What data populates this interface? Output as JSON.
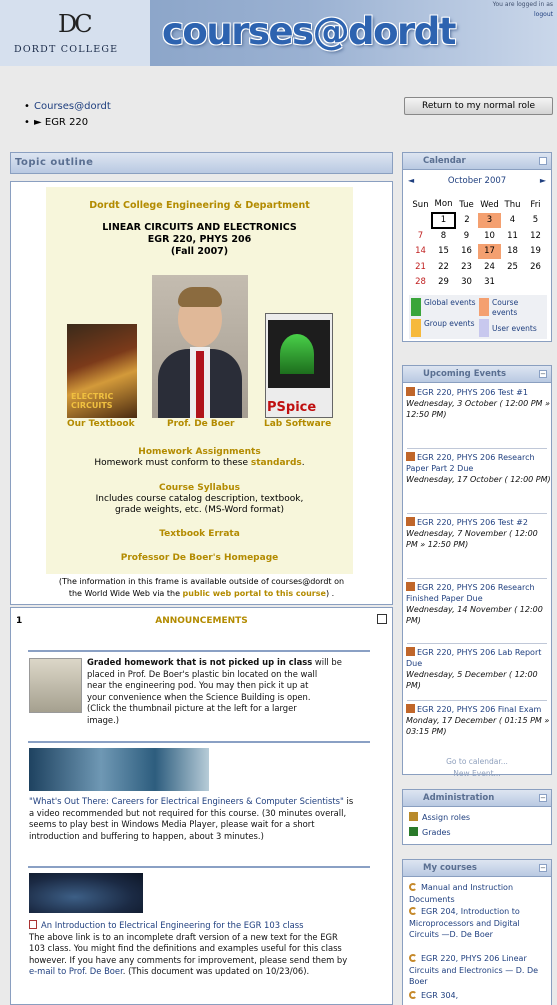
{
  "header": {
    "site_title": "courses@dordt",
    "logo_mark": "DC",
    "logo_text": "DORDT COLLEGE",
    "login_info": "You are logged in as",
    "logout": "logout"
  },
  "breadcrumb": [
    {
      "label": "Courses@dordt"
    },
    {
      "label": "► EGR 220"
    }
  ],
  "role_button": "Return to my normal role",
  "topic_outline": "Topic outline",
  "frame": {
    "title": "Dordt College Engineering & Department",
    "course_line1": "LINEAR CIRCUITS AND ELECTRONICS",
    "course_line2": "EGR 220, PHYS 206",
    "course_line3": "(Fall 2007)",
    "textbook_label": "Our Textbook",
    "textbook_cover": "ELECTRIC CIRCUITS",
    "prof_label": "Prof. De Boer",
    "software_label": "Lab Software",
    "pspice": "PSpice",
    "homework_title": "Homework Assignments",
    "homework_text": "Homework must conform to these",
    "homework_link": "standards",
    "syllabus_title": "Course Syllabus",
    "syllabus_text1": "Includes course catalog description, textbook,",
    "syllabus_text2": "grade weights, etc. (MS-Word format)",
    "errata": "Textbook Errata",
    "homepage": "Professor De Boer's Homepage"
  },
  "frame_note": {
    "line1": "(The information in this frame is available outside of courses@dordt on",
    "line2_pre": "the World Wide Web via the",
    "line2_link": "public web portal to this course",
    "line2_post": ") ."
  },
  "section1": {
    "number": "1",
    "title": "ANNOUNCEMENTS",
    "hw_bold": "Graded homework that is not picked up in class",
    "hw_text1": " will be",
    "hw_lines": [
      "placed in Prof. De Boer's plastic bin located on the wall",
      "near the engineering pod. You may then pick it up at",
      "your convenience when the Science Building is open.",
      "(Click the thumbnail picture at the left for a larger",
      "image.)"
    ],
    "video_link": "\"What's Out There: Careers for Electrical Engineers & Computer Scientists\"",
    "video_text_lead": " is",
    "video_lines": [
      "a video recommended but not required for this course. (30 minutes overall,",
      "seems to play best in Windows Media Player, please wait for a short",
      "introduction and buffering to happen, about 3 minutes.)"
    ],
    "intro_link": "An Introduction to Electrical Engineering for the EGR 103 class",
    "intro_lines": [
      "The above link is to an incomplete draft version of a new text for the EGR",
      "103 class.  You might find the definitions and examples useful for this class",
      "however.  If you have any comments for improvement, please send them by"
    ],
    "intro_email": "e-mail to Prof. De Boer",
    "intro_tail": ". (This document was updated on 10/23/06)."
  },
  "calendar": {
    "title": "Calendar",
    "month": "October 2007",
    "prev": "◄",
    "next": "►",
    "days": [
      "Sun",
      "Mon",
      "Tue",
      "Wed",
      "Thu",
      "Fri"
    ],
    "weeks": [
      [
        "",
        "1",
        "2",
        "3",
        "4",
        "5"
      ],
      [
        "7",
        "8",
        "9",
        "10",
        "11",
        "12"
      ],
      [
        "14",
        "15",
        "16",
        "17",
        "18",
        "19"
      ],
      [
        "21",
        "22",
        "23",
        "24",
        "25",
        "26"
      ],
      [
        "28",
        "29",
        "30",
        "31",
        "",
        ""
      ]
    ],
    "legend": {
      "global": "Global events",
      "course": "Course events",
      "group": "Group events",
      "user": "User events"
    }
  },
  "upcoming": {
    "title": "Upcoming Events",
    "events": [
      {
        "name": "EGR 220, PHYS 206 Test #1",
        "date": "Wednesday, 3 October",
        "time": "( 12:00 PM » 12:50 PM)"
      },
      {
        "name": "EGR 220, PHYS 206 Research Paper Part 2 Due",
        "date": "Wednesday, 17 October",
        "time": "( 12:00 PM)"
      },
      {
        "name": "EGR 220, PHYS 206 Test #2",
        "date": "Wednesday, 7 November",
        "time": "( 12:00 PM » 12:50 PM)"
      },
      {
        "name": "EGR 220, PHYS 206 Research Finished Paper Due",
        "date": "Wednesday, 14 November",
        "time": "( 12:00 PM)"
      },
      {
        "name": "EGR 220, PHYS 206 Lab Report Due",
        "date": "Wednesday, 5 December",
        "time": "( 12:00 PM)"
      },
      {
        "name": "EGR 220, PHYS 206 Final Exam",
        "date": "Monday, 17 December",
        "time": "( 01:15 PM » 03:15 PM)"
      }
    ],
    "goto_calendar": "Go to calendar...",
    "new_event": "New Event..."
  },
  "administration": {
    "title": "Administration",
    "items": [
      "Assign roles",
      "Grades"
    ]
  },
  "my_courses": {
    "title": "My courses",
    "items": [
      "Manual and Instruction Documents",
      "EGR 204, Introduction to Microprocessors and Digital Circuits —D. De Boer",
      "EGR 220, PHYS 206 Linear Circuits and Electronics — D. De Boer",
      "EGR 304,"
    ]
  },
  "colors": {
    "accent": "#b38b00",
    "link": "#1f3f7f",
    "header_blue": "#2d63b0",
    "course_event": "#f4a070",
    "global_event": "#3aa53a"
  }
}
